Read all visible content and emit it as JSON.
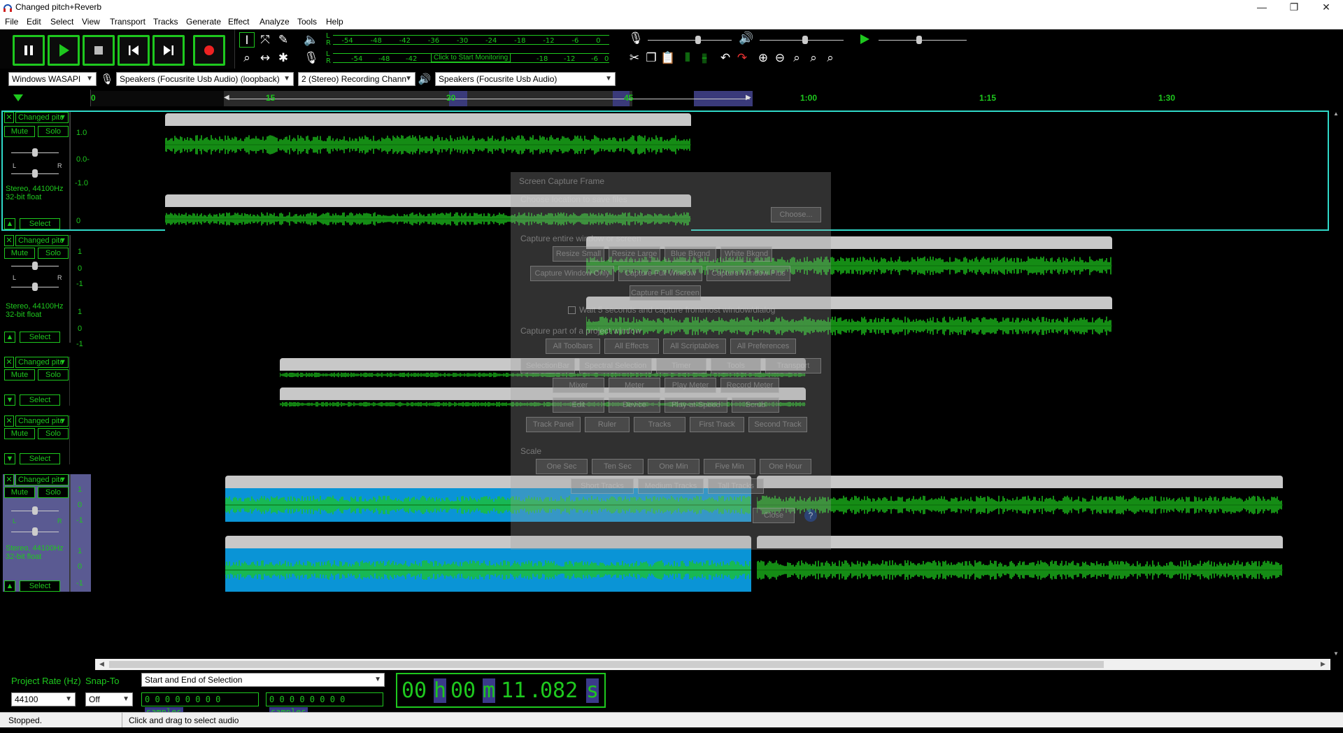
{
  "window": {
    "title": "Changed pitch+Reverb",
    "min": "—",
    "restore": "❐",
    "close": "✕"
  },
  "menu": [
    "File",
    "Edit",
    "Select",
    "View",
    "Transport",
    "Tracks",
    "Generate",
    "Effect",
    "Analyze",
    "Tools",
    "Help"
  ],
  "meters": {
    "ticks": [
      "-54",
      "-48",
      "-42",
      "-36",
      "-30",
      "-24",
      "-18",
      "-12",
      "-6",
      "0"
    ],
    "ticks2": [
      "-54",
      "-48",
      "-42",
      "-18",
      "-12",
      "-6",
      "0"
    ],
    "monitor_label": "Click to Start Monitoring",
    "lr": [
      "L",
      "R"
    ]
  },
  "device_bar": {
    "host": "Windows WASAPI",
    "recording_device": "Speakers (Focusrite Usb Audio) (loopback)",
    "channels": "2 (Stereo) Recording Chann",
    "playback_device": "Speakers (Focusrite Usb Audio)"
  },
  "ruler": {
    "labels": [
      "0",
      "15",
      "30",
      "45",
      "1:00",
      "1:15",
      "1:30"
    ]
  },
  "tracks": [
    {
      "name": "Changed pitc",
      "mute": "Mute",
      "solo": "Solo",
      "info1": "Stereo, 44100Hz",
      "info2": "32-bit float",
      "select": "Select",
      "scale": [
        "1.0",
        "0.0-",
        "-1.0",
        "0"
      ]
    },
    {
      "name": "Changed pitc",
      "mute": "Mute",
      "solo": "Solo",
      "info1": "Stereo, 44100Hz",
      "info2": "32-bit float",
      "select": "Select",
      "scale": [
        "1",
        "0",
        "-1",
        "1",
        "0",
        "-1"
      ]
    },
    {
      "name": "Changed pitc",
      "mute": "Mute",
      "solo": "Solo",
      "select": "Select"
    },
    {
      "name": "Changed pitc",
      "mute": "Mute",
      "solo": "Solo",
      "select": "Select"
    },
    {
      "name": "Changed pitc",
      "mute": "Mute",
      "solo": "Solo",
      "info1": "Stereo, 44100Hz",
      "info2": "32-bit float",
      "select": "Select",
      "scale": [
        "1",
        "0",
        "-1",
        "1",
        "0",
        "-1"
      ]
    }
  ],
  "pan": {
    "l": "L",
    "r": "R"
  },
  "dialog": {
    "title": "Screen Capture Frame",
    "save_loc": "Choose location to save files",
    "choose": "Choose...",
    "sec1": "Capture entire window or screen",
    "row1": [
      "Resize Small",
      "Resize Large",
      "Blue Bkgnd",
      "White Bkgnd"
    ],
    "row2": [
      "Capture Window Only",
      "Capture Full Window",
      "Capture Window Plus"
    ],
    "full_screen": "Capture Full Screen",
    "wait": "Wait 5 seconds and capture frontmost window/dialog",
    "sec2": "Capture part of a project window",
    "row3": [
      "All Toolbars",
      "All Effects",
      "All Scriptables",
      "All Preferences"
    ],
    "row4": [
      "SelectionBar",
      "Spectral Selection",
      "Timer",
      "Tools",
      "Transport"
    ],
    "row5": [
      "Mixer",
      "Meter",
      "Play Meter",
      "Record Meter"
    ],
    "row6": [
      "Edit",
      "Device",
      "Play-at-Speed",
      "Scrub"
    ],
    "row7": [
      "Track Panel",
      "Ruler",
      "Tracks",
      "First Track",
      "Second Track"
    ],
    "sec3": "Scale",
    "row8": [
      "One Sec",
      "Ten Sec",
      "One Min",
      "Five Min",
      "One Hour"
    ],
    "row9": [
      "Short Tracks",
      "Medium Tracks",
      "Tall Tracks"
    ],
    "close": "Close"
  },
  "bottom": {
    "rate_label": "Project Rate (Hz)",
    "snap_label": "Snap-To",
    "rate": "44100",
    "snap": "Off",
    "selection_mode": "Start and End of Selection",
    "sel_start": "0 0 0 0 0 0 0 0",
    "sel_end": "0 0 0 0 0 0 0 0",
    "sel_unit": "samples",
    "time_hours": "00",
    "time_h": "h",
    "time_minutes": "00",
    "time_m": "m",
    "time_seconds": "11",
    "time_ms": "082",
    "time_s": "s"
  },
  "status": {
    "state": "Stopped.",
    "hint": "Click and drag to select audio"
  },
  "colors": {
    "accent": "#1ec81e",
    "selected_clip": "#0a94d6",
    "track_select": "#6a6aa0"
  }
}
